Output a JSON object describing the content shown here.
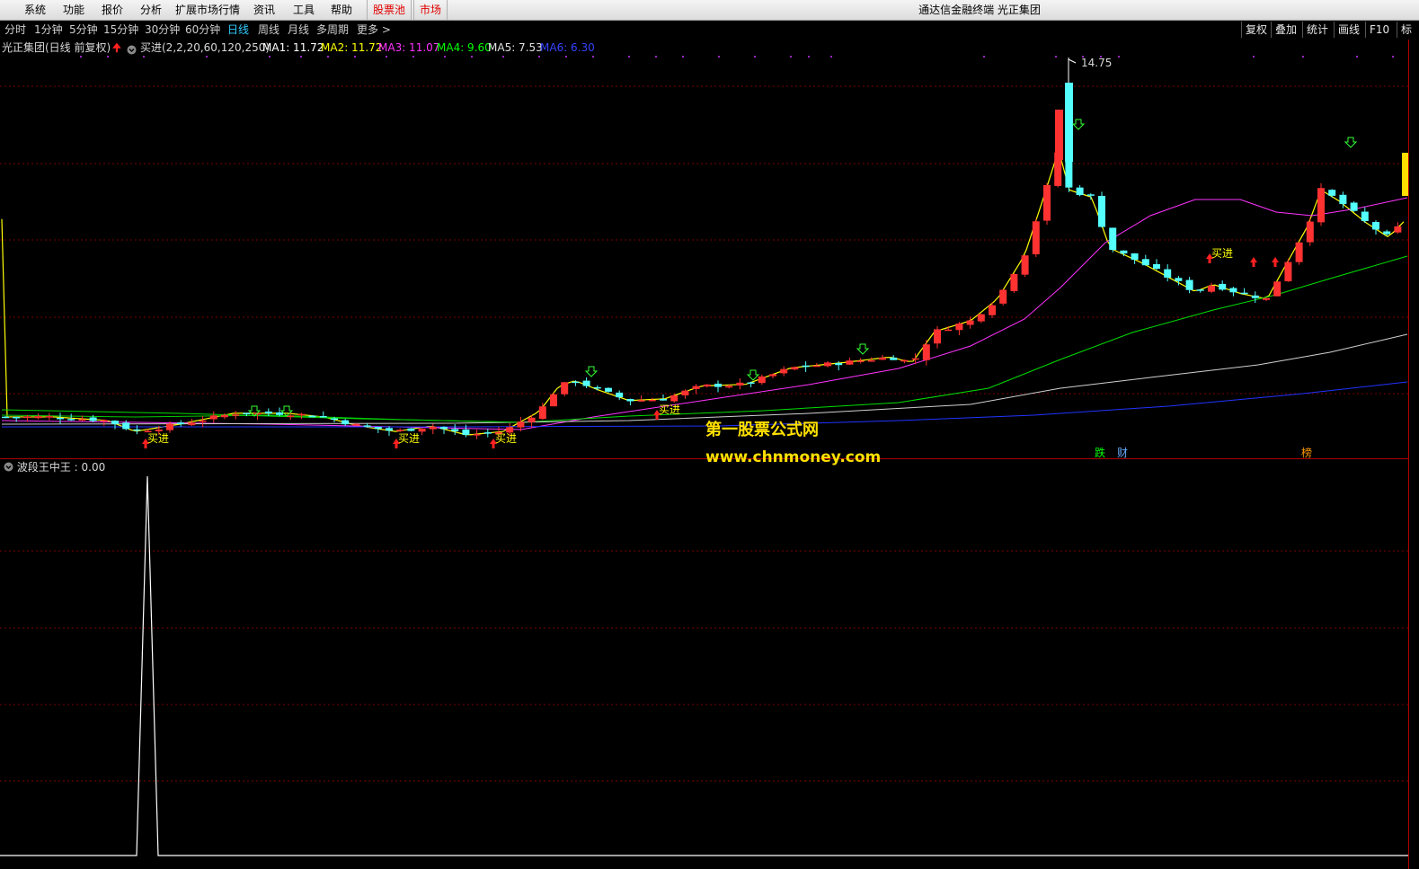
{
  "menu": {
    "items": [
      "系统",
      "功能",
      "报价",
      "分析",
      "扩展市场行情",
      "资讯",
      "工具",
      "帮助"
    ],
    "stock_pool": "股票池",
    "market": "市场",
    "app_title": "通达信金融终端 光正集团"
  },
  "periods": {
    "items": [
      "分时",
      "1分钟",
      "5分钟",
      "15分钟",
      "30分钟",
      "60分钟",
      "日线",
      "周线",
      "月线",
      "多周期",
      "更多 >"
    ],
    "active": "日线"
  },
  "toolbar": [
    "复权",
    "叠加",
    "统计",
    "画线",
    "F10",
    "标"
  ],
  "info": {
    "stock_title": "光正集团(日线 前复权)",
    "indicator": "买进(2,2,20,60,120,250)",
    "ma": [
      {
        "label": "MA1: 11.72",
        "color": "#ffffff"
      },
      {
        "label": "MA2: 11.72",
        "color": "#ffff00"
      },
      {
        "label": "MA3: 11.07",
        "color": "#ff33ff"
      },
      {
        "label": "MA4: 9.60",
        "color": "#00ff00"
      },
      {
        "label": "MA5: 7.53",
        "color": "#e0e0e0"
      },
      {
        "label": "MA6: 6.30",
        "color": "#3344ff"
      }
    ]
  },
  "main_chart": {
    "peak_label": "14.75",
    "buy_label": "买进",
    "buy_markers": [
      170,
      449,
      557,
      739,
      1354
    ],
    "tags": [
      {
        "text": "跌",
        "color": "#00ff00"
      },
      {
        "text": "财",
        "color": "#66aaff"
      },
      {
        "text": "榜",
        "color": "#ff9900"
      }
    ]
  },
  "sub_panel": {
    "label": "波段王中王 : 0.00"
  },
  "watermark": {
    "line1": "第一股票公式网",
    "line2": "www.chnmoney.com"
  },
  "colors": {
    "up": "#ff3232",
    "down": "#54ffff",
    "grid": "#7a0000",
    "ma_white": "#ffffff",
    "ma_yellow": "#ffff00",
    "ma_magenta": "#ff33ff",
    "ma_green": "#00dd00",
    "ma_gray": "#d0d0d0",
    "ma_blue": "#2233ff"
  }
}
